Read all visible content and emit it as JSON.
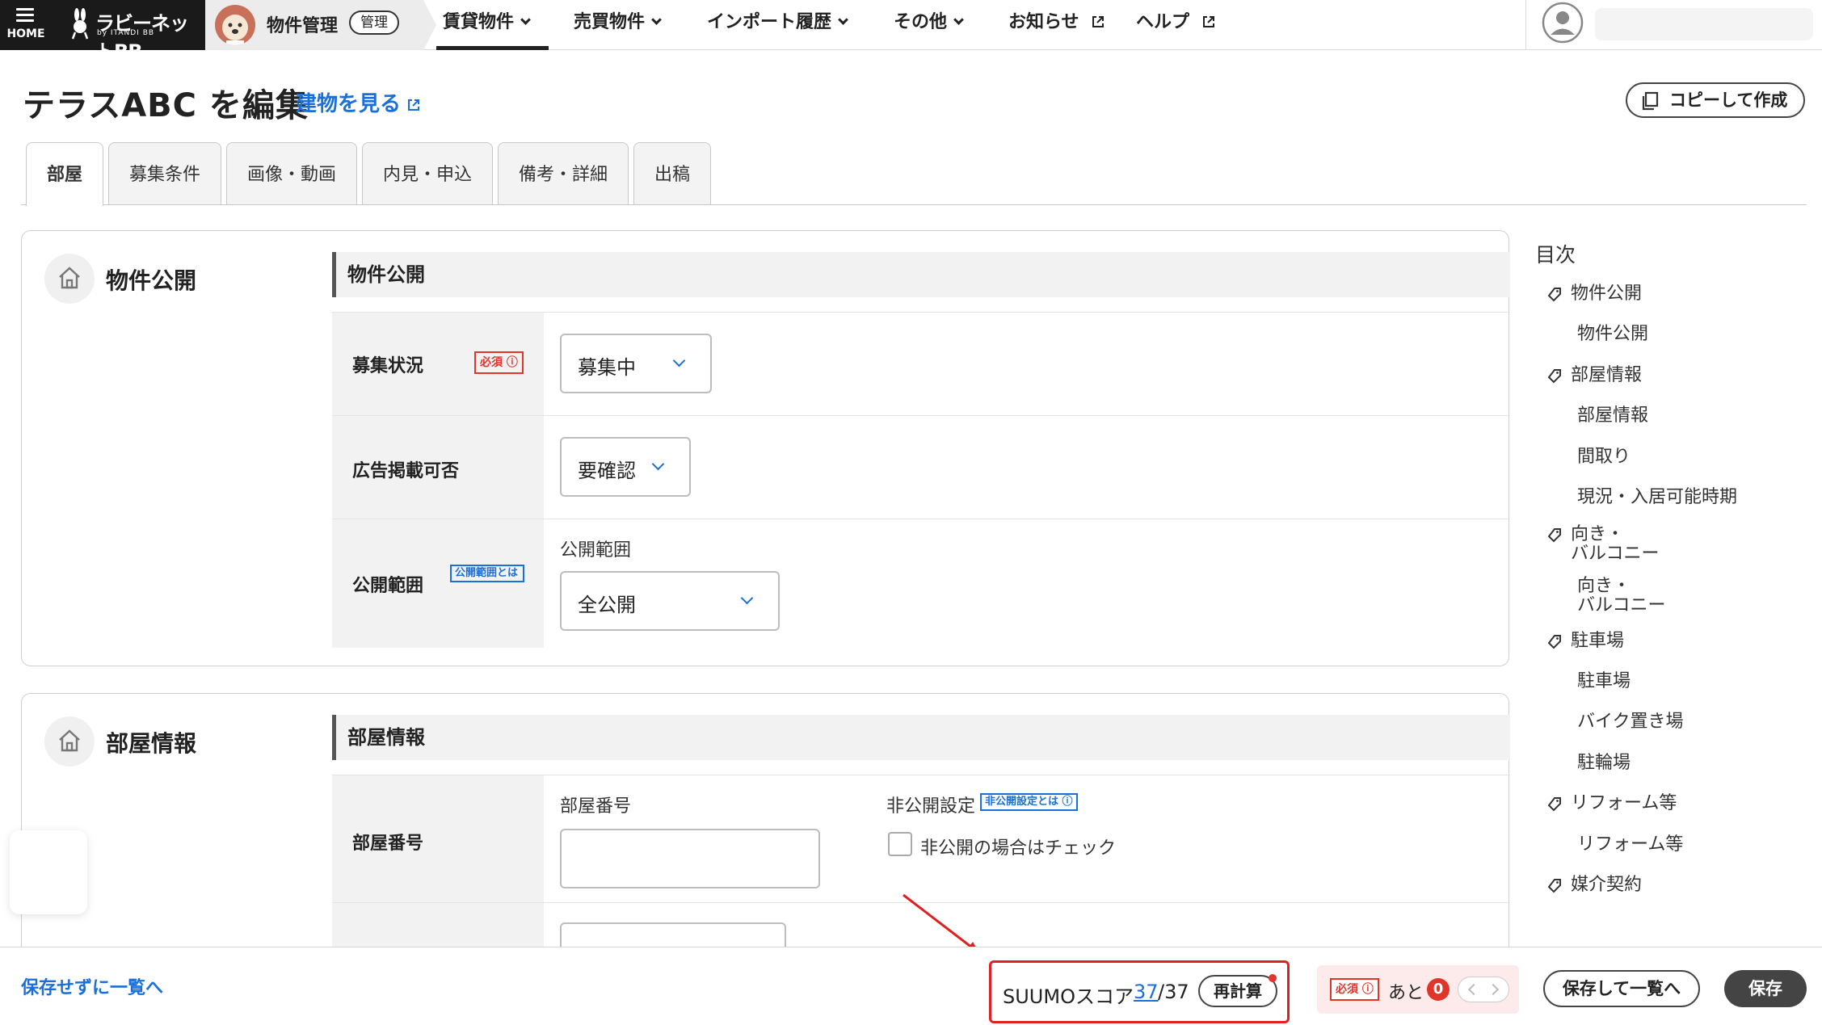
{
  "topbar": {
    "home_label": "HOME",
    "brand_name": "ラビーネットBB",
    "brand_sub": "by ITANDI BB",
    "mgmt_label": "物件管理",
    "mgmt_badge": "管理",
    "nav": [
      {
        "label": "賃貸物件",
        "active": true
      },
      {
        "label": "売買物件"
      },
      {
        "label": "インポート履歴"
      },
      {
        "label": "その他"
      },
      {
        "label": "お知らせ"
      },
      {
        "label": "ヘルプ"
      }
    ]
  },
  "page": {
    "title": "テラスABC を編集",
    "building_link": "建物を見る",
    "copy_button": "コピーして作成"
  },
  "tabs": [
    "部屋",
    "募集条件",
    "画像・動画",
    "内見・申込",
    "備考・詳細",
    "出稿"
  ],
  "sections": {
    "publish": {
      "title": "物件公開",
      "subhead": "物件公開",
      "status_label": "募集状況",
      "status_required": "必須",
      "status_value": "募集中",
      "ad_label": "広告掲載可否",
      "ad_value": "要確認",
      "scope_label": "公開範囲",
      "scope_info": "公開範囲とは",
      "scope_caption": "公開範囲",
      "scope_value": "全公開"
    },
    "room": {
      "title": "部屋情報",
      "subhead": "部屋情報",
      "room_no_label": "部屋番号",
      "room_no_caption": "部屋番号",
      "room_no_value": "",
      "private_caption": "非公開設定",
      "private_info": "非公開設定とは",
      "private_checkbox_label": "非公開の場合はチェック"
    }
  },
  "toc": {
    "title": "目次",
    "items": [
      {
        "label": "物件公開",
        "level": "main"
      },
      {
        "label": "物件公開",
        "level": "sub"
      },
      {
        "label": "部屋情報",
        "level": "main"
      },
      {
        "label": "部屋情報",
        "level": "sub"
      },
      {
        "label": "間取り",
        "level": "sub"
      },
      {
        "label": "現況・入居可能時期",
        "level": "sub"
      },
      {
        "label": "向き・\nバルコニー",
        "level": "main"
      },
      {
        "label": "向き・\nバルコニー",
        "level": "sub"
      },
      {
        "label": "駐車場",
        "level": "main"
      },
      {
        "label": "駐車場",
        "level": "sub"
      },
      {
        "label": "バイク置き場",
        "level": "sub"
      },
      {
        "label": "駐輪場",
        "level": "sub"
      },
      {
        "label": "リフォーム等",
        "level": "main"
      },
      {
        "label": "リフォーム等",
        "level": "sub"
      },
      {
        "label": "媒介契約",
        "level": "main"
      }
    ]
  },
  "bottom": {
    "back_link": "保存せずに一覧へ",
    "score_label": "SUUMOスコア",
    "score_value": "37",
    "score_max": "/37",
    "recalc": "再計算",
    "required_badge": "必須",
    "remaining_label": "あと",
    "remaining_count": "0",
    "save_to_list": "保存して一覧へ",
    "save": "保存"
  },
  "colors": {
    "link": "#1a6fd8",
    "required": "#e0352b",
    "highlight": "#e02020",
    "dark": "#1a1a1a"
  }
}
